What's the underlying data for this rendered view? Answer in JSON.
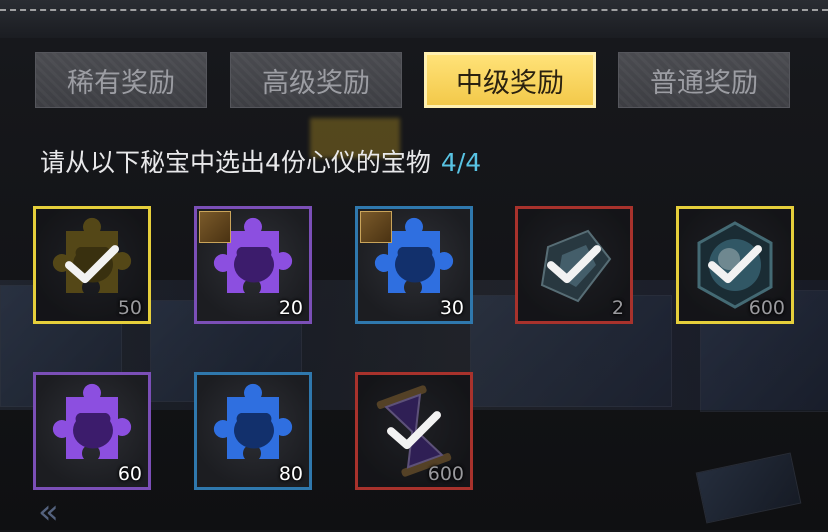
{
  "tabs": [
    {
      "label": "稀有奖励",
      "active": false
    },
    {
      "label": "高级奖励",
      "active": false
    },
    {
      "label": "中级奖励",
      "active": true
    },
    {
      "label": "普通奖励",
      "active": false
    }
  ],
  "prompt": {
    "text": "请从以下秘宝中选出4份心仪的宝物",
    "count": "4/4"
  },
  "items": [
    {
      "quantity": "50",
      "rarity_color": "#e6cf3b",
      "icon": "gold-puzzle-piece-icon",
      "selected": true,
      "badge": false
    },
    {
      "quantity": "20",
      "rarity_color": "#7b4fb7",
      "icon": "purple-puzzle-piece-icon",
      "selected": false,
      "badge": true
    },
    {
      "quantity": "30",
      "rarity_color": "#2f78ad",
      "icon": "blue-puzzle-piece-icon",
      "selected": false,
      "badge": true
    },
    {
      "quantity": "2",
      "rarity_color": "#a8322c",
      "icon": "crystal-box-icon",
      "selected": true,
      "badge": false
    },
    {
      "quantity": "600",
      "rarity_color": "#e6cf3b",
      "icon": "crystal-orb-icon",
      "selected": true,
      "badge": false
    },
    {
      "quantity": "60",
      "rarity_color": "#7b4fb7",
      "icon": "purple-puzzle-piece-icon",
      "selected": false,
      "badge": false
    },
    {
      "quantity": "80",
      "rarity_color": "#2f78ad",
      "icon": "blue-puzzle-piece-icon",
      "selected": false,
      "badge": false
    },
    {
      "quantity": "600",
      "rarity_color": "#a8322c",
      "icon": "hourglass-icon",
      "selected": true,
      "badge": false
    }
  ]
}
